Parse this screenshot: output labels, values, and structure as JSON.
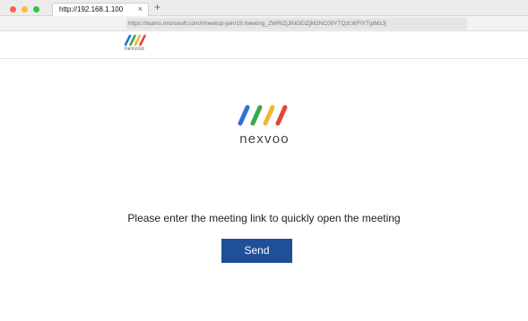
{
  "browser": {
    "tab_title": "http://192.168.1.100",
    "tab_close_glyph": "×",
    "new_tab_glyph": "+",
    "url": "https://teams.microsoft.com/l/meetup-join/19:meeting_ZWRlZjJlNGEtZjM2NC00YTQzLWFlYTgtMzJj"
  },
  "brand": {
    "name": "nexvoo",
    "stripe_colors": [
      "#2f6fd6",
      "#3aa84a",
      "#f2b632",
      "#e2453b"
    ]
  },
  "main": {
    "prompt": "Please enter the meeting link to quickly open the meeting",
    "send_label": "Send",
    "button_color": "#1f4f96"
  }
}
